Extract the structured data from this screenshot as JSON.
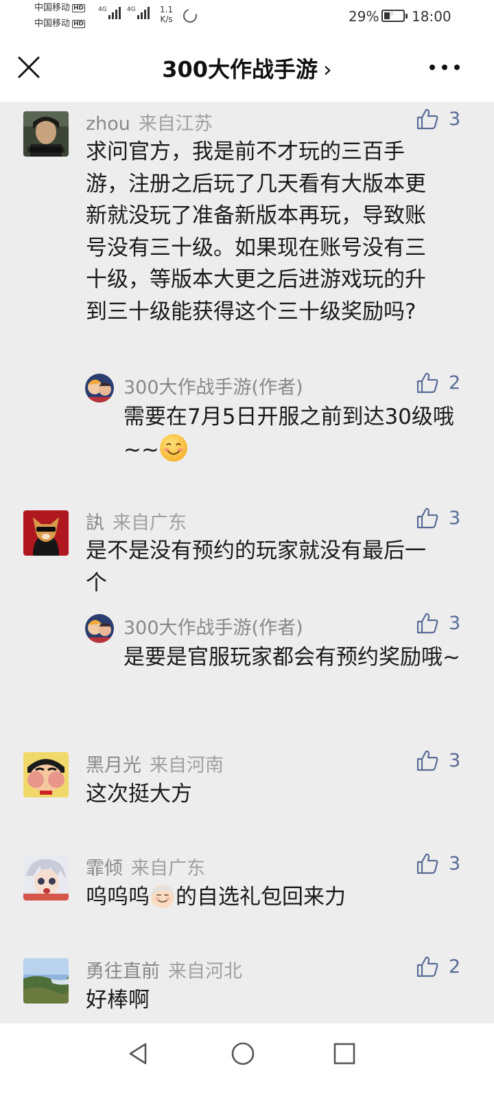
{
  "status_bar": {
    "carrier_1": "中国移动",
    "carrier_2": "中国移动",
    "hd_badge": "HD",
    "network_type": "4G",
    "net_speed_value": "1.1",
    "net_speed_unit": "K/s",
    "battery": "29%",
    "battery_level": 0.29,
    "time": "18:00"
  },
  "header": {
    "title": "300大作战手游",
    "chevron": "›"
  },
  "comments": [
    {
      "user": "zhou",
      "location": "来自江苏",
      "likes": "3",
      "text": "求问官方，我是前不才玩的三百手游，注册之后玩了几天看有大版本更新就没玩了准备新版本再玩，导致账号没有三十级。如果现在账号没有三十级，等版本大更之后进游戏玩的升到三十级能获得这个三十级奖励吗?",
      "reply": {
        "user": "300大作战手游(作者)",
        "likes": "2",
        "text": "需要在7月5日开服之前到达30级哦~~",
        "emoji": "smile-emoji"
      }
    },
    {
      "user": "訙",
      "location": "来自广东",
      "likes": "3",
      "text": "是不是没有预约的玩家就没有最后一个",
      "reply": {
        "user": "300大作战手游(作者)",
        "likes": "3",
        "text": "是要是官服玩家都会有预约奖励哦~"
      }
    },
    {
      "user": "黑月光",
      "location": "来自河南",
      "likes": "3",
      "text": "这次挺大方"
    },
    {
      "user": "霏倾",
      "location": "来自广东",
      "likes": "3",
      "text_before": "呜呜呜",
      "text_after": "的自选礼包回来力",
      "emoji": "old-man-emoji"
    },
    {
      "user": "勇往直前",
      "location": "来自河北",
      "likes": "2",
      "text": "好棒啊"
    }
  ],
  "icons": {
    "close": "close-icon",
    "more": "more-icon",
    "like": "thumbs-up-icon",
    "nav_back": "back-triangle-icon",
    "nav_home": "home-circle-icon",
    "nav_recent": "recent-apps-square-icon"
  },
  "colors": {
    "like_blue": "#576b95",
    "background": "#ededed",
    "name_gray": "#888888"
  }
}
